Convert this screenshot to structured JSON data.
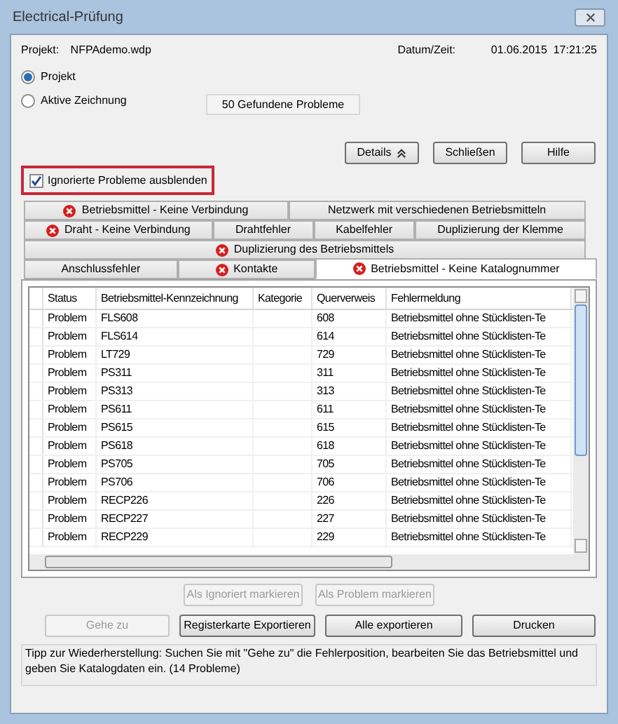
{
  "window": {
    "title": "Electrical-Prüfung"
  },
  "project": {
    "label": "Projekt:",
    "value": "NFPAdemo.wdp",
    "date_label": "Datum/Zeit:",
    "date_value": "01.06.2015  17:21:25"
  },
  "scope": [
    {
      "label": "Projekt",
      "selected": true
    },
    {
      "label": "Aktive Zeichnung",
      "selected": false
    }
  ],
  "found": "50 Gefundene Probleme",
  "top_buttons": [
    {
      "label": "Details",
      "kind": "expander"
    },
    {
      "label": "Schließen",
      "kind": "plain"
    },
    {
      "label": "Hilfe",
      "kind": "plain"
    }
  ],
  "hide_ignored": {
    "label": "Ignorierte Probleme ausblenden",
    "checked": true
  },
  "tab_rows": [
    [
      {
        "label": "Betriebsmittel - Keine Verbindung",
        "error": true,
        "selected": false
      },
      {
        "label": "Netzwerk mit verschiedenen Betriebsmitteln",
        "error": false,
        "selected": false
      }
    ],
    [
      {
        "label": "Draht - Keine Verbindung",
        "error": true,
        "selected": false
      },
      {
        "label": "Drahtfehler",
        "error": false,
        "selected": false
      },
      {
        "label": "Kabelfehler",
        "error": false,
        "selected": false
      },
      {
        "label": "Duplizierung der Klemme",
        "error": false,
        "selected": false
      }
    ],
    [
      {
        "label": "Duplizierung des Betriebsmittels",
        "error": true,
        "selected": false
      }
    ],
    [
      {
        "label": "Anschlussfehler",
        "error": false,
        "selected": false
      },
      {
        "label": "Kontakte",
        "error": true,
        "selected": false
      },
      {
        "label": "Betriebsmittel - Keine Katalognummer",
        "error": true,
        "selected": true
      }
    ]
  ],
  "table": {
    "columns": [
      "Status",
      "Betriebsmittel-Kennzeichnung",
      "Kategorie",
      "Querverweis",
      "Fehlermeldung"
    ],
    "rows": [
      {
        "status": "Problem",
        "designation": "FLS608",
        "cross_reference": "608",
        "message": "Betriebsmittel ohne Stücklisten-Te"
      },
      {
        "status": "Problem",
        "designation": "FLS614",
        "cross_reference": "614",
        "message": "Betriebsmittel ohne Stücklisten-Te"
      },
      {
        "status": "Problem",
        "designation": "LT729",
        "cross_reference": "729",
        "message": "Betriebsmittel ohne Stücklisten-Te"
      },
      {
        "status": "Problem",
        "designation": "PS311",
        "cross_reference": "311",
        "message": "Betriebsmittel ohne Stücklisten-Te"
      },
      {
        "status": "Problem",
        "designation": "PS313",
        "cross_reference": "313",
        "message": "Betriebsmittel ohne Stücklisten-Te"
      },
      {
        "status": "Problem",
        "designation": "PS611",
        "cross_reference": "611",
        "message": "Betriebsmittel ohne Stücklisten-Te"
      },
      {
        "status": "Problem",
        "designation": "PS615",
        "cross_reference": "615",
        "message": "Betriebsmittel ohne Stücklisten-Te"
      },
      {
        "status": "Problem",
        "designation": "PS618",
        "cross_reference": "618",
        "message": "Betriebsmittel ohne Stücklisten-Te"
      },
      {
        "status": "Problem",
        "designation": "PS705",
        "cross_reference": "705",
        "message": "Betriebsmittel ohne Stücklisten-Te"
      },
      {
        "status": "Problem",
        "designation": "PS706",
        "cross_reference": "706",
        "message": "Betriebsmittel ohne Stücklisten-Te"
      },
      {
        "status": "Problem",
        "designation": "RECP226",
        "cross_reference": "226",
        "message": "Betriebsmittel ohne Stücklisten-Te"
      },
      {
        "status": "Problem",
        "designation": "RECP227",
        "cross_reference": "227",
        "message": "Betriebsmittel ohne Stücklisten-Te"
      },
      {
        "status": "Problem",
        "designation": "RECP229",
        "cross_reference": "229",
        "message": "Betriebsmittel ohne Stücklisten-Te"
      }
    ]
  },
  "mark_buttons": [
    {
      "label": "Als Ignoriert markieren",
      "disabled": true
    },
    {
      "label": "Als Problem markieren",
      "disabled": true
    }
  ],
  "action_buttons": [
    {
      "label": "Gehe zu",
      "disabled": true
    },
    {
      "label": "Registerkarte Exportieren",
      "disabled": false
    },
    {
      "label": "Alle exportieren",
      "disabled": false
    },
    {
      "label": "Drucken",
      "disabled": false
    }
  ],
  "tip": "Tipp zur Wiederherstellung: Suchen Sie mit \"Gehe zu\" die Fehlerposition, bearbeiten Sie das Betriebsmittel und geben Sie Katalogdaten ein. (14 Probleme)"
}
